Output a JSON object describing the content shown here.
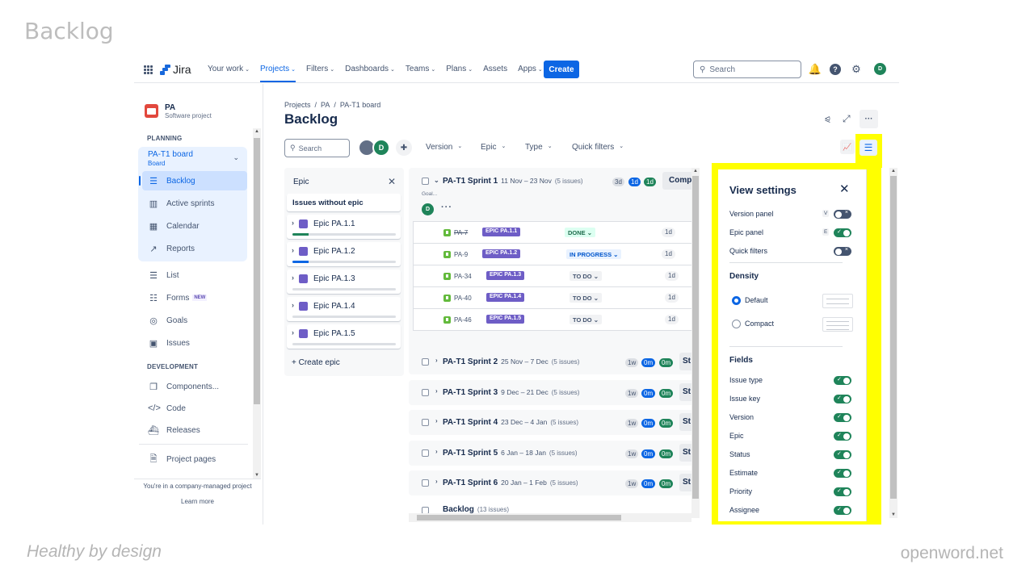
{
  "slide": {
    "title": "Backlog",
    "footer_left": "Healthy by design",
    "footer_right": "openword.net"
  },
  "topnav": {
    "app_name": "Jira",
    "items": [
      {
        "label": "Your work",
        "dropdown": true
      },
      {
        "label": "Projects",
        "dropdown": true,
        "active": true
      },
      {
        "label": "Filters",
        "dropdown": true
      },
      {
        "label": "Dashboards",
        "dropdown": true
      },
      {
        "label": "Teams",
        "dropdown": true
      },
      {
        "label": "Plans",
        "dropdown": true
      },
      {
        "label": "Assets",
        "dropdown": false
      },
      {
        "label": "Apps",
        "dropdown": true
      }
    ],
    "create_label": "Create",
    "search_placeholder": "Search",
    "icons": [
      "notifications-icon",
      "help-icon",
      "settings-icon"
    ],
    "user_initial": "D"
  },
  "sidebar": {
    "project_name": "PA",
    "project_type": "Software project",
    "planning_title": "PLANNING",
    "board_name": "PA-T1 board",
    "board_sub": "Board",
    "planning_items": [
      {
        "label": "Backlog",
        "icon": "backlog-icon",
        "active": true
      },
      {
        "label": "Active sprints",
        "icon": "columns-icon"
      },
      {
        "label": "Calendar",
        "icon": "calendar-icon"
      },
      {
        "label": "Reports",
        "icon": "reports-icon"
      }
    ],
    "other_items": [
      {
        "label": "List",
        "icon": "list-icon"
      },
      {
        "label": "Forms",
        "icon": "forms-icon",
        "badge": "NEW"
      },
      {
        "label": "Goals",
        "icon": "goals-icon"
      },
      {
        "label": "Issues",
        "icon": "issues-icon"
      }
    ],
    "development_title": "DEVELOPMENT",
    "development_items": [
      {
        "label": "Components...",
        "icon": "components-icon"
      },
      {
        "label": "Code",
        "icon": "code-icon"
      },
      {
        "label": "Releases",
        "icon": "releases-icon"
      }
    ],
    "project_pages": "Project pages",
    "footer_text": "You're in a company-managed project",
    "learn_more": "Learn more"
  },
  "main": {
    "breadcrumb": [
      "Projects",
      "PA",
      "PA-T1 board"
    ],
    "title": "Backlog",
    "search_placeholder": "Search",
    "avatar_initial": "D",
    "filters": [
      "Version",
      "Epic",
      "Type",
      "Quick filters"
    ]
  },
  "epic_panel": {
    "title": "Epic",
    "no_epic": "Issues without epic",
    "epics": [
      {
        "name": "Epic PA.1.1",
        "progress": 0.16,
        "progress_color": "#1f845a"
      },
      {
        "name": "Epic PA.1.2",
        "progress": 0.16,
        "progress_color": "#0c66e4"
      },
      {
        "name": "Epic PA.1.3",
        "progress": 0
      },
      {
        "name": "Epic PA.1.4",
        "progress": 0
      },
      {
        "name": "Epic PA.1.5",
        "progress": 0
      }
    ],
    "create_label": "+ Create epic"
  },
  "sprint1": {
    "name": "PA-T1 Sprint 1",
    "dates": "11 Nov – 23 Nov",
    "count": "(5 issues)",
    "goal": "Goal...",
    "pills": [
      "3d",
      "1d",
      "1d"
    ],
    "action": "Compl",
    "assignee_initial": "D",
    "issues": [
      {
        "key": "PA-7",
        "epic": "EPIC PA.1.1",
        "status": "DONE",
        "status_type": "done",
        "estimate": "1d"
      },
      {
        "key": "PA-9",
        "epic": "EPIC PA.1.2",
        "status": "IN PROGRESS",
        "status_type": "prog",
        "estimate": "1d"
      },
      {
        "key": "PA-34",
        "epic": "EPIC PA.1.3",
        "status": "TO DO",
        "status_type": "todo",
        "estimate": "1d"
      },
      {
        "key": "PA-40",
        "epic": "EPIC PA.1.4",
        "status": "TO DO",
        "status_type": "todo",
        "estimate": "1d"
      },
      {
        "key": "PA-46",
        "epic": "EPIC PA.1.5",
        "status": "TO DO",
        "status_type": "todo",
        "estimate": "1d"
      }
    ]
  },
  "sprints": [
    {
      "name": "PA-T1 Sprint 2",
      "dates": "25 Nov – 7 Dec",
      "count": "(5 issues)",
      "pills": [
        "1w",
        "0m",
        "0m"
      ],
      "action": "St"
    },
    {
      "name": "PA-T1 Sprint 3",
      "dates": "9 Dec – 21 Dec",
      "count": "(5 issues)",
      "pills": [
        "1w",
        "0m",
        "0m"
      ],
      "action": "St"
    },
    {
      "name": "PA-T1 Sprint 4",
      "dates": "23 Dec – 4 Jan",
      "count": "(5 issues)",
      "pills": [
        "1w",
        "0m",
        "0m"
      ],
      "action": "St"
    },
    {
      "name": "PA-T1 Sprint 5",
      "dates": "6 Jan – 18 Jan",
      "count": "(5 issues)",
      "pills": [
        "1w",
        "0m",
        "0m"
      ],
      "action": "St"
    },
    {
      "name": "PA-T1 Sprint 6",
      "dates": "20 Jan – 1 Feb",
      "count": "(5 issues)",
      "pills": [
        "1w",
        "0m",
        "0m"
      ],
      "action": "St"
    }
  ],
  "backlog": {
    "name": "Backlog",
    "count": "(13 issues)"
  },
  "view_settings": {
    "title": "View settings",
    "panels": [
      {
        "label": "Version panel",
        "shortcut": "V",
        "on": false
      },
      {
        "label": "Epic panel",
        "shortcut": "E",
        "on": true
      },
      {
        "label": "Quick filters",
        "shortcut": "",
        "on": false
      }
    ],
    "density_title": "Density",
    "density_options": [
      {
        "label": "Default",
        "selected": true
      },
      {
        "label": "Compact",
        "selected": false
      }
    ],
    "fields_title": "Fields",
    "fields": [
      {
        "label": "Issue type",
        "on": true
      },
      {
        "label": "Issue key",
        "on": true
      },
      {
        "label": "Version",
        "on": true
      },
      {
        "label": "Epic",
        "on": true
      },
      {
        "label": "Status",
        "on": true
      },
      {
        "label": "Estimate",
        "on": true
      },
      {
        "label": "Priority",
        "on": true
      },
      {
        "label": "Assignee",
        "on": true
      }
    ]
  },
  "colors": {
    "highlight": "#ffff00",
    "brand_blue": "#0c66e4",
    "success_green": "#1f845a",
    "epic_purple": "#6e5dc6"
  }
}
